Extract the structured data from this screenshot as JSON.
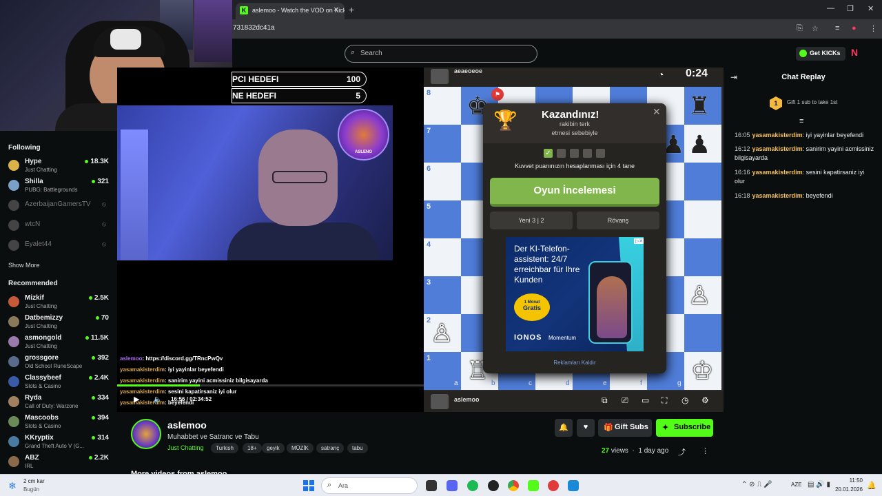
{
  "browser": {
    "tab_title": "aslemoo - Watch the VOD on Kick",
    "favicon_letter": "K",
    "new_tab": "+",
    "url": "731832dc41a",
    "win_min": "—",
    "win_max": "❐",
    "win_close": "✕"
  },
  "header": {
    "search_placeholder": "Search",
    "get_kicks": "Get KICKs"
  },
  "sidebar": {
    "following_title": "Following",
    "following": [
      {
        "name": "Hype",
        "category": "Just Chatting",
        "viewers": "18.3K",
        "color": "#d9b24a",
        "online": true
      },
      {
        "name": "Shilla",
        "category": "PUBG: Battlegrounds",
        "viewers": "321",
        "color": "#7aa0c8",
        "online": true
      },
      {
        "name": "AzerbaijanGamersTV",
        "category": "",
        "viewers": "",
        "color": "#444",
        "online": false
      },
      {
        "name": "wtcN",
        "category": "",
        "viewers": "",
        "color": "#444",
        "online": false
      },
      {
        "name": "Eyalet44",
        "category": "",
        "viewers": "",
        "color": "#444",
        "online": false
      }
    ],
    "show_more": "Show More",
    "recommended_title": "Recommended",
    "recommended": [
      {
        "name": "Mizkif",
        "category": "Just Chatting",
        "viewers": "2.5K",
        "color": "#c45a3a"
      },
      {
        "name": "Datbemizzy",
        "category": "Just Chatting",
        "viewers": "70",
        "color": "#8a7a5a"
      },
      {
        "name": "asmongold",
        "category": "Just Chatting",
        "viewers": "11.5K",
        "color": "#9a7aaa"
      },
      {
        "name": "grossgore",
        "category": "Old School RuneScape",
        "viewers": "392",
        "color": "#5a6a8a"
      },
      {
        "name": "Classybeef",
        "category": "Slots & Casino",
        "viewers": "2.4K",
        "color": "#3a5aa8"
      },
      {
        "name": "Ryda",
        "category": "Call of Duty: Warzone",
        "viewers": "334",
        "color": "#a08060"
      },
      {
        "name": "Mascoobs",
        "category": "Slots & Casino",
        "viewers": "394",
        "color": "#6a8a5a"
      },
      {
        "name": "KKryptix",
        "category": "Grand Theft Auto V (G...",
        "viewers": "314",
        "color": "#4a7aa0"
      },
      {
        "name": "ABZ",
        "category": "IRL",
        "viewers": "2.2K",
        "color": "#8a6a4a"
      }
    ]
  },
  "video": {
    "goal1_label": "PCI HEDEFI",
    "goal1_value": "100",
    "goal2_label": "NE HEDEFI",
    "goal2_value": "5",
    "lion_text": "ASLENO",
    "overlay_chat": [
      {
        "user": "aslemoo",
        "msg": ": https://discord.gg/TRncPwQv"
      },
      {
        "user": "yasamakisterdim",
        "msg": ": iyi yayinlar beyefendi"
      },
      {
        "user": "yasamakisterdim",
        "msg": ": sanirim yayini acmissiniz bilgisayarda"
      },
      {
        "user": "yasamakisterdim",
        "msg": ": sesini kapatirsaniz iyi olur"
      },
      {
        "user": "yasamakisterdim",
        "msg": ": beyefendi"
      }
    ],
    "time": "16:56 / 02:34:52",
    "progress": 0.27
  },
  "chess": {
    "opponent": "aeaeoeoe",
    "player": "aslemoo",
    "clock": "0:24",
    "ranks": [
      "8",
      "7",
      "6",
      "5",
      "4",
      "3",
      "2",
      "1"
    ],
    "files": [
      "a",
      "b",
      "c",
      "d",
      "e",
      "f",
      "g"
    ],
    "modal": {
      "title": "Kazandınız!",
      "reason_line1": "rakibin terk",
      "reason_line2": "etmesi sebebiyle",
      "rating_text": "Kuvvet puanınızın hesaplanması için 4 tane",
      "review_button": "Oyun İncelemesi",
      "new_game": "Yeni 3 | 2",
      "rematch": "Rövanş",
      "remove_ads": "Reklamları Kaldır",
      "close": "✕"
    },
    "ad": {
      "text": "Der KI-Telefon-assistent: 24/7 erreichbar für Ihre Kunden",
      "badge_line1": "1 Monat",
      "badge_line2": "Gratis",
      "brand": "IONOS",
      "product": "Momentum"
    }
  },
  "chat": {
    "title": "Chat Replay",
    "gift_rank": "1",
    "gift_text": "Gift 1 sub to take 1st",
    "messages": [
      {
        "time": "16:05",
        "user": "yasamakisterdim",
        "msg": ": iyi yayinlar beyefendi"
      },
      {
        "time": "16:12",
        "user": "yasamakisterdim",
        "msg": ": sanirim yayini acmissiniz bilgisayarda"
      },
      {
        "time": "16:16",
        "user": "yasamakisterdim",
        "msg": ": sesini kapatirsaniz iyi olur"
      },
      {
        "time": "16:18",
        "user": "yasamakisterdim",
        "msg": ": beyefendi"
      }
    ]
  },
  "channel": {
    "name": "aslemoo",
    "stream_title": "Muhabbet ve Satranc ve Tabu",
    "category": "Just Chatting",
    "tags": [
      "Turkish",
      "18+",
      "geyik",
      "MÜZİK",
      "satranç",
      "tabu"
    ],
    "gift_subs": "Gift Subs",
    "subscribe": "Subscribe",
    "views_count": "27",
    "views_label": "views",
    "age": "1 day ago",
    "more_videos": "More videos from aslemoo"
  },
  "taskbar": {
    "weather_temp": "2 cm kar",
    "weather_day": "Bugün",
    "search": "Ara",
    "lang": "AZE",
    "time": "11:50",
    "date": "20.01.2026"
  }
}
